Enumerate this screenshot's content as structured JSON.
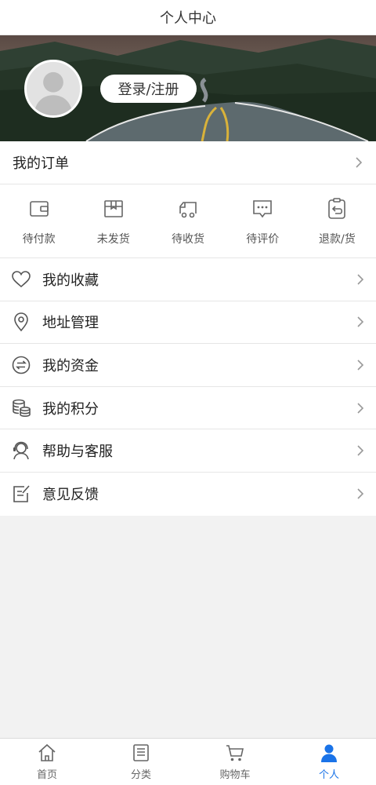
{
  "header": {
    "title": "个人中心"
  },
  "profile": {
    "login_label": "登录/注册"
  },
  "orders": {
    "title": "我的订单",
    "items": [
      {
        "label": "待付款",
        "icon": "wallet-icon"
      },
      {
        "label": "未发货",
        "icon": "box-icon"
      },
      {
        "label": "待收货",
        "icon": "truck-icon"
      },
      {
        "label": "待评价",
        "icon": "comment-icon"
      },
      {
        "label": "退款/货",
        "icon": "refund-icon"
      }
    ]
  },
  "menu": [
    {
      "label": "我的收藏",
      "icon": "heart-icon"
    },
    {
      "label": "地址管理",
      "icon": "location-icon"
    },
    {
      "label": "我的资金",
      "icon": "exchange-icon"
    },
    {
      "label": "我的积分",
      "icon": "coins-icon"
    },
    {
      "label": "帮助与客服",
      "icon": "support-icon"
    },
    {
      "label": "意见反馈",
      "icon": "feedback-icon"
    }
  ],
  "tabbar": {
    "items": [
      {
        "label": "首页",
        "icon": "home-icon"
      },
      {
        "label": "分类",
        "icon": "category-icon"
      },
      {
        "label": "购物车",
        "icon": "cart-icon"
      },
      {
        "label": "个人",
        "icon": "user-icon"
      }
    ],
    "active_color": "#1a73e8",
    "inactive_color": "#666666"
  }
}
